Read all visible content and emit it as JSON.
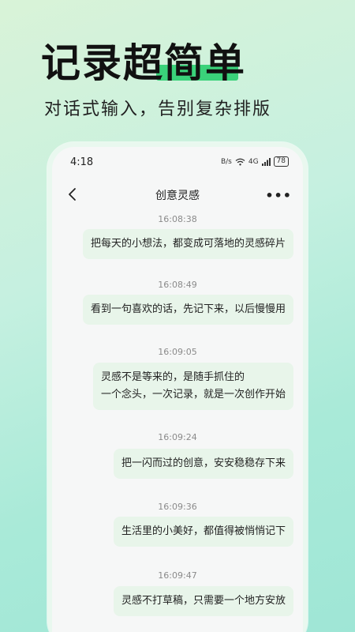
{
  "hero": {
    "title": "记录超简单",
    "subtitle": "对话式输入，告别复杂排版"
  },
  "status_bar": {
    "time": "4:18",
    "network_speed": "B/s",
    "signal": "4G",
    "battery": "78"
  },
  "nav": {
    "title": "创意灵感",
    "more": "•••"
  },
  "messages": [
    {
      "time": "16:08:38",
      "text": "把每天的小想法，都变成可落地的灵感碎片"
    },
    {
      "time": "16:08:49",
      "text": "看到一句喜欢的话，先记下来，以后慢慢用"
    },
    {
      "time": "16:09:05",
      "line1": "灵感不是等来的，是随手抓住的",
      "line2": "一个念头，一次记录，就是一次创作开始"
    },
    {
      "time": "16:09:24",
      "text": "把一闪而过的创意，安安稳稳存下来"
    },
    {
      "time": "16:09:36",
      "text": "生活里的小美好，都值得被悄悄记下"
    },
    {
      "time": "16:09:47",
      "text": "灵感不打草稿，只需要一个地方安放"
    }
  ],
  "colors": {
    "accent": "#3ad27a",
    "bubble": "#e8f5ea"
  }
}
